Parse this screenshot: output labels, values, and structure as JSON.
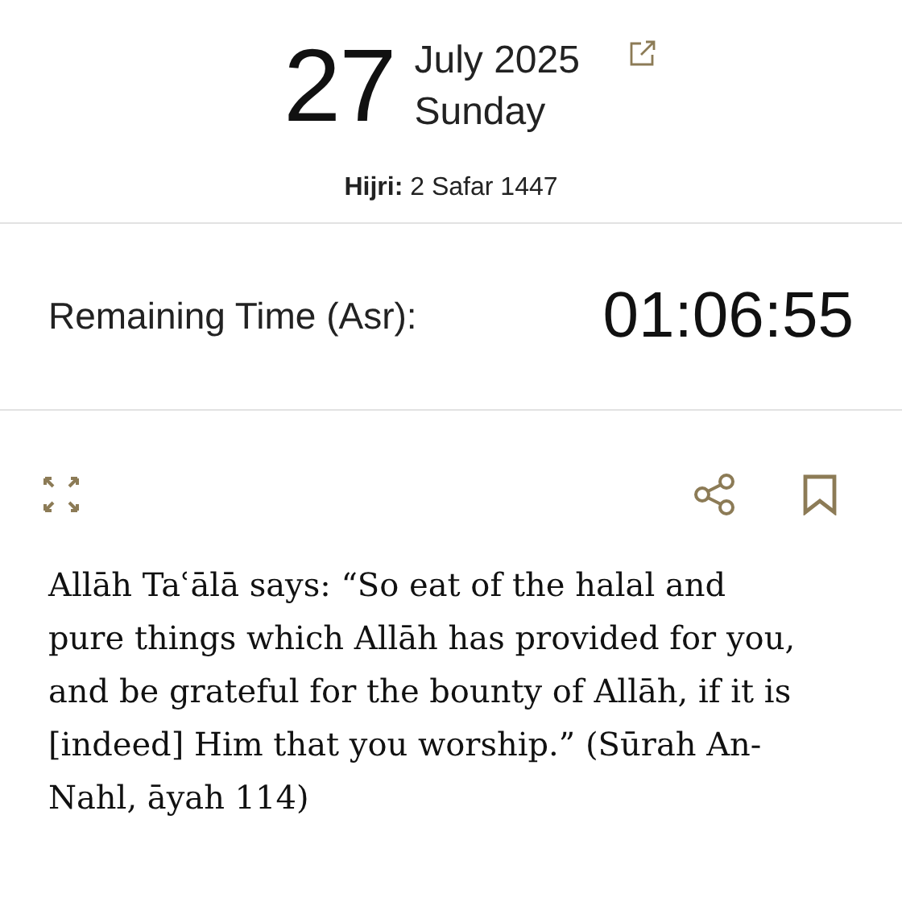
{
  "date": {
    "day": "27",
    "month_year": "July 2025",
    "weekday": "Sunday",
    "hijri": "**Hijri:** 2 Safar 1447"
  },
  "remaining": {
    "label": "Remaining Time (Asr):",
    "time": "01:06:55"
  },
  "quote": {
    "text": "Allāh Taʿālā says: “So eat of the halal and pure things which Allāh has provided for you, and be grateful for the bounty of Allāh, if it is [indeed] Him that you worship.” (Sūrah An-Nahl, āyah 114)"
  }
}
